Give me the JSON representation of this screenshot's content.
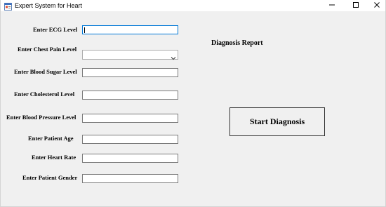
{
  "window": {
    "title": "Expert System for Heart"
  },
  "form": {
    "fields": [
      {
        "label": "Enter ECG Level",
        "value": ""
      },
      {
        "label": "Enter Chest Pain Level",
        "value": ""
      },
      {
        "label": "Enter Blood Sugar Level",
        "value": ""
      },
      {
        "label": "Enter Cholesterol Level",
        "value": ""
      },
      {
        "label": "Enter Blood Pressure Level",
        "value": ""
      },
      {
        "label": "Enter Patient Age",
        "value": ""
      },
      {
        "label": "Enter Heart Rate",
        "value": ""
      },
      {
        "label": "Enter Patient Gender",
        "value": ""
      }
    ]
  },
  "report": {
    "label": "Diagnosis Report"
  },
  "actions": {
    "start_label": "Start Diagnosis"
  },
  "colors": {
    "focus_border": "#0078d7",
    "background": "#f0f0f0"
  },
  "icons": {
    "app": "app-window-icon",
    "minimize": "minimize-icon",
    "maximize": "maximize-icon",
    "close": "close-icon",
    "dropdown": "chevron-down-icon"
  }
}
